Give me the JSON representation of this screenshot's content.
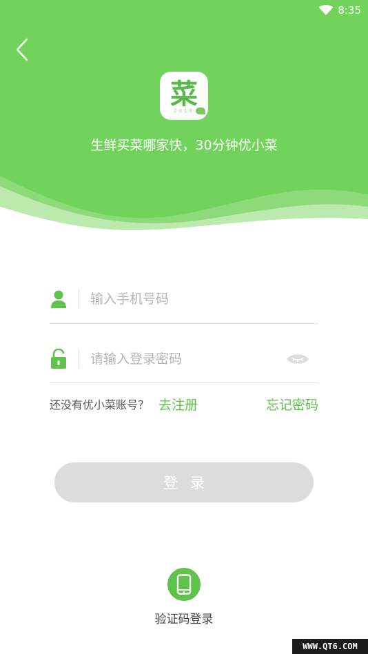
{
  "status_bar": {
    "time": "8:35"
  },
  "header": {
    "logo_char": "菜",
    "logo_year": "2019",
    "slogan": "生鲜买菜哪家快，30分钟优小菜"
  },
  "form": {
    "phone_placeholder": "输入手机号码",
    "password_placeholder": "请输入登录密码"
  },
  "links": {
    "no_account": "还没有优小菜账号？",
    "register": "去注册",
    "forgot": "忘记密码"
  },
  "login_button": {
    "label": "登录"
  },
  "sms_login": {
    "label": "验证码登录"
  },
  "watermark": "WWW.QT6.COM",
  "colors": {
    "brand_green": "#72d35c",
    "link_green": "#5fc24a",
    "button_disabled": "#dcdcdc"
  }
}
